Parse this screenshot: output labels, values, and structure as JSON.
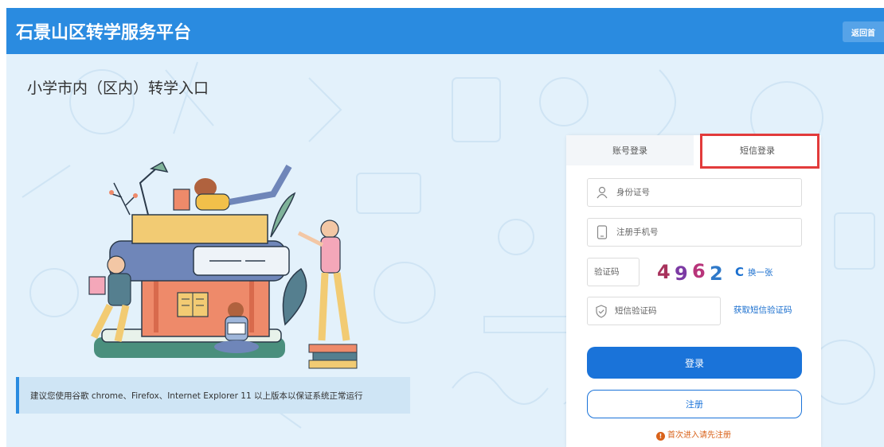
{
  "header": {
    "title": "石景山区转学服务平台",
    "back_label": "返回首"
  },
  "page": {
    "title": "小学市内（区内）转学入口"
  },
  "notice": {
    "text": "建议您使用谷歌 chrome、Firefox、Internet Explorer 11 以上版本以保证系统正常运行"
  },
  "login": {
    "tabs": [
      {
        "label": "账号登录"
      },
      {
        "label": "短信登录"
      }
    ],
    "id_placeholder": "身份证号",
    "phone_placeholder": "注册手机号",
    "captcha_placeholder": "验证码",
    "captcha_code": "4962",
    "refresh_label": "换一张",
    "sms_placeholder": "短信验证码",
    "get_code_label": "获取短信验证码",
    "login_button": "登录",
    "register_button": "注册",
    "first_tip": "首次进入请先注册"
  },
  "colors": {
    "brand_blue": "#2a8be0",
    "button_blue": "#1a73d9",
    "highlight_red": "#e23b3b",
    "tip_orange": "#d9621a"
  }
}
